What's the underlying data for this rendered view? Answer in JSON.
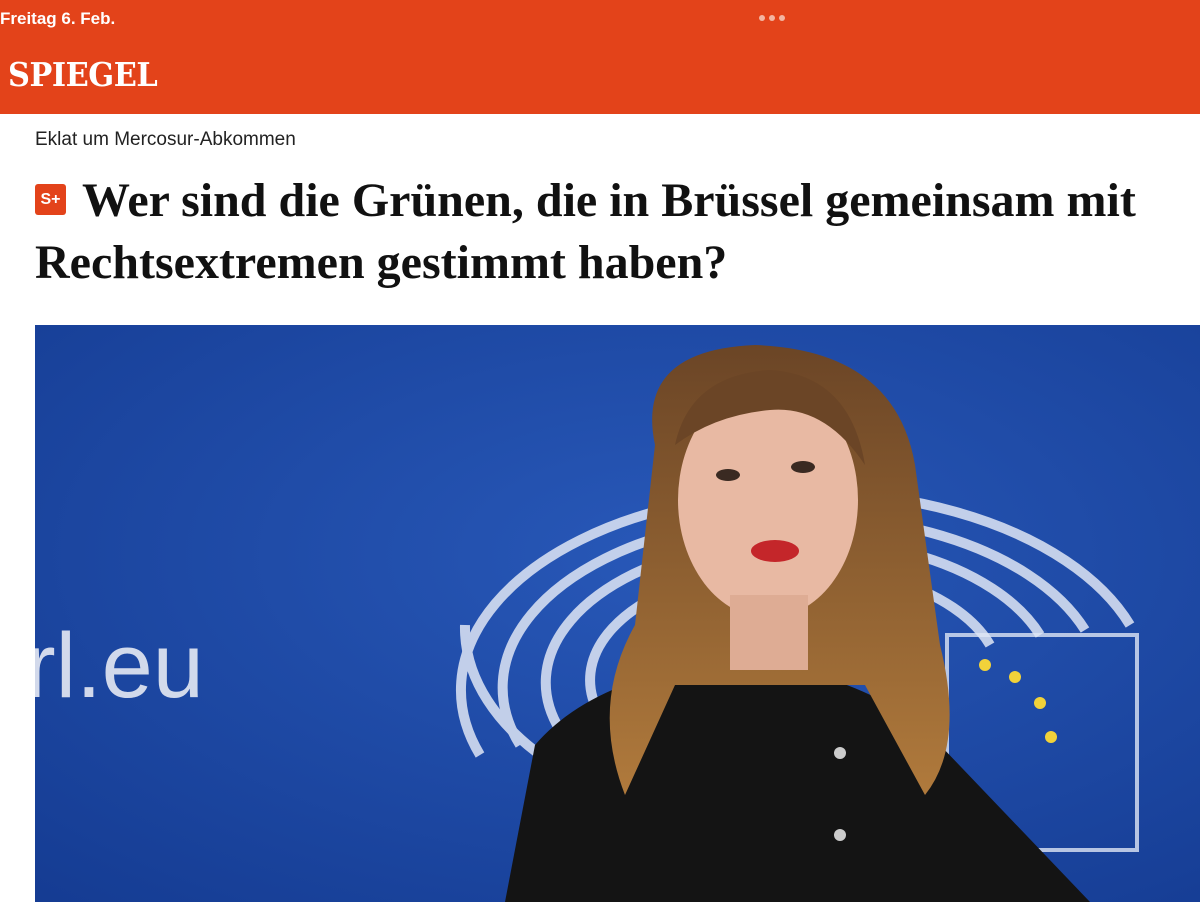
{
  "status_bar": {
    "date": "Freitag 6. Feb."
  },
  "header": {
    "logo": "SPIEGEL"
  },
  "article": {
    "kicker": "Eklat um Mercosur-Abkommen",
    "badge": "S+",
    "headline_line1": "Wer sind die Grünen, die in Brüssel gemeinsam mit",
    "headline_line2": "Rechtsextremen gestimmt haben?",
    "photo_backdrop_text": "rl.eu"
  },
  "colors": {
    "brand": "#e3431a",
    "backdrop": "#1b4aa8"
  },
  "icons": {
    "status_dots": "more-dots-icon"
  }
}
